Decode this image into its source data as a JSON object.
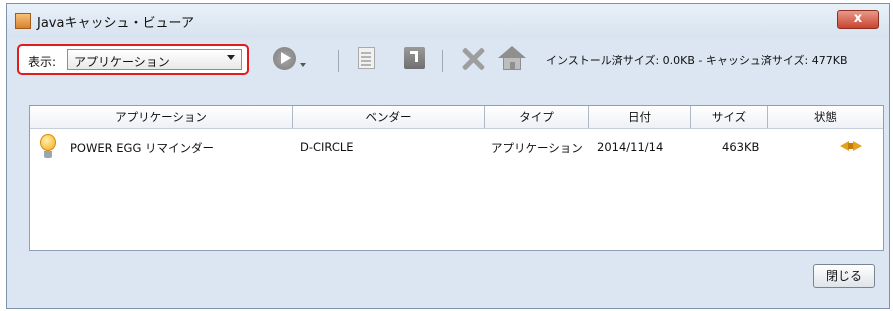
{
  "window": {
    "title": "Javaキャッシュ・ビューア",
    "close_label": "x"
  },
  "toolbar": {
    "view_label": "表示:",
    "view_value": "アプリケーション",
    "size_info": "インストール済サイズ: 0.0KB - キャッシュ済サイズ: 477KB"
  },
  "table": {
    "columns": [
      "アプリケーション",
      "ベンダー",
      "タイプ",
      "日付",
      "サイズ",
      "状態"
    ],
    "rows": [
      {
        "name": "POWER EGG リマインダー",
        "vendor": "D-CIRCLE",
        "type": "アプリケーション",
        "date": "2014/11/14",
        "size": "463KB",
        "status_icon": "status-arrows-icon"
      }
    ]
  },
  "footer": {
    "close_button_label": "閉じる"
  },
  "icons": [
    "java-cup-icon",
    "play-icon",
    "document-icon",
    "share-icon",
    "delete-icon",
    "home-icon",
    "lightbulb-icon",
    "status-arrows-icon"
  ],
  "colors": {
    "highlight": "#e21b1b",
    "close_button": "#c94431",
    "status_icon": "#e2a21b"
  }
}
